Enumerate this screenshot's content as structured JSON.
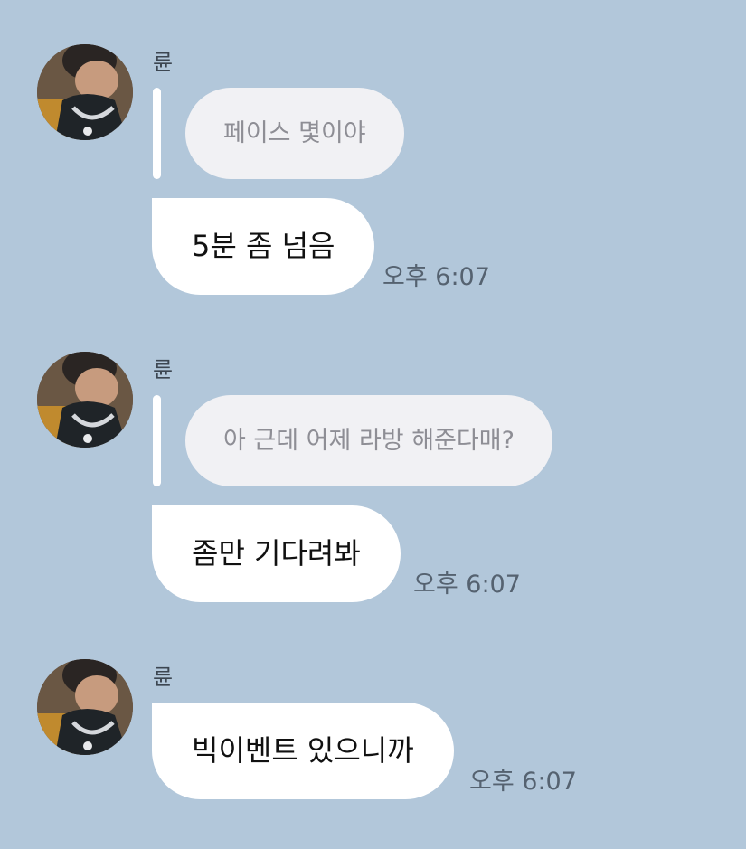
{
  "chat": {
    "messages": [
      {
        "sender": "륜",
        "avatar_icon": "profile-photo-avatar",
        "quoted_text": "페이스 몇이야",
        "text": "5분 좀 넘음",
        "time": "오후 6:07"
      },
      {
        "sender": "륜",
        "avatar_icon": "profile-photo-avatar",
        "quoted_text": "아 근데 어제 라방 해준다매?",
        "text": "좀만 기다려봐",
        "time": "오후 6:07"
      },
      {
        "sender": "륜",
        "avatar_icon": "profile-photo-avatar",
        "text": "빅이벤트 있으니까",
        "time": "오후 6:07"
      }
    ]
  },
  "colors": {
    "background": "#b2c7da",
    "bubble": "#ffffff",
    "quote_bubble": "#f1f1f4",
    "quote_text": "#8e8e95",
    "timestamp": "#556270"
  }
}
